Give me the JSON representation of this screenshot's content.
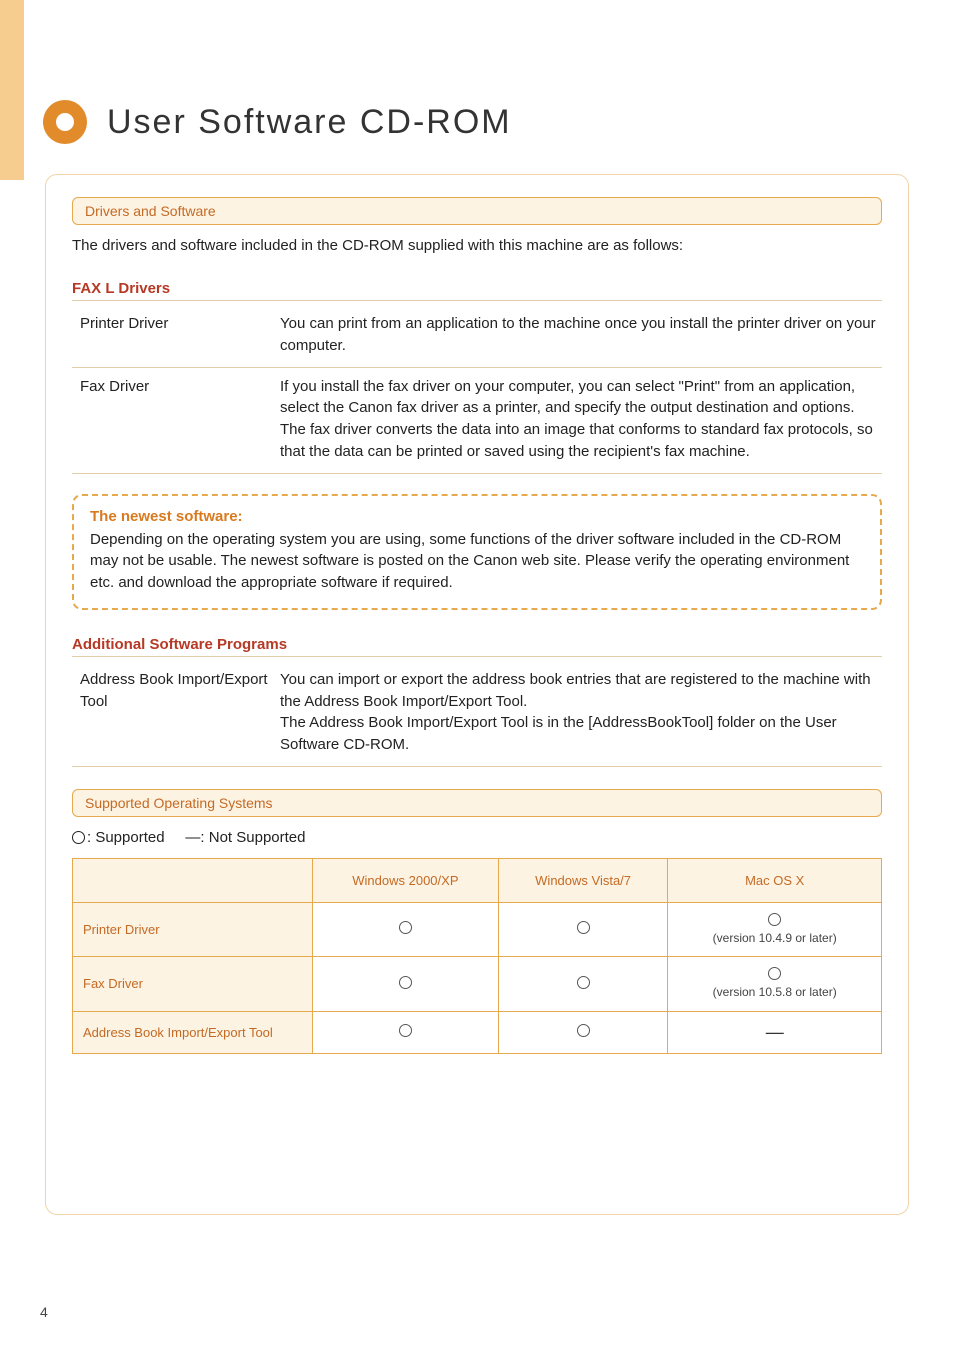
{
  "page_number": "4",
  "title": "User Software CD-ROM",
  "section_drivers_label": "Drivers and Software",
  "intro_text": "The drivers and software included in the CD-ROM supplied with this machine are as follows:",
  "fax_l_heading": "FAX L Drivers",
  "drivers": [
    {
      "name": "Printer Driver",
      "desc": "You can print from an application to the machine once you install the printer driver on your computer."
    },
    {
      "name": "Fax Driver",
      "desc": "If you install the fax driver on your computer, you can select \"Print\" from an application, select the Canon fax driver as a printer, and specify the output destination and options. The fax driver converts the data into an image that conforms to standard fax protocols, so that the data can be printed or saved using the recipient's fax machine."
    }
  ],
  "notice": {
    "title": "The newest software:",
    "body": "Depending on the operating system you are using, some functions of the driver software included in the CD-ROM may not be usable. The newest software is posted on the Canon web site. Please verify the operating environment etc. and download the appropriate software if required."
  },
  "additional_heading": "Additional Software Programs",
  "additional": [
    {
      "name": "Address Book Import/Export Tool",
      "desc_line1": "You can import or export the address book entries that are registered to the machine with the Address Book Import/Export Tool.",
      "desc_line2": "The Address Book Import/Export Tool is in the [AddressBookTool] folder on the User Software CD-ROM."
    }
  ],
  "section_os_label": "Supported Operating Systems",
  "legend_supported": ": Supported",
  "legend_not_supported": "—: Not Supported",
  "os_table": {
    "columns": [
      "Windows 2000/XP",
      "Windows Vista/7",
      "Mac OS X"
    ],
    "rows": [
      {
        "label": "Printer Driver",
        "cells": [
          "circle",
          "circle",
          {
            "type": "circle_note",
            "note": "(version 10.4.9 or later)"
          }
        ]
      },
      {
        "label": "Fax Driver",
        "cells": [
          "circle",
          "circle",
          {
            "type": "circle_note",
            "note": "(version 10.5.8 or later)"
          }
        ]
      },
      {
        "label": "Address Book Import/Export Tool",
        "cells": [
          "circle",
          "circle",
          "dash"
        ]
      }
    ]
  },
  "chart_data": {
    "type": "table",
    "title": "Supported Operating Systems",
    "columns": [
      "",
      "Windows 2000/XP",
      "Windows Vista/7",
      "Mac OS X"
    ],
    "rows": [
      [
        "Printer Driver",
        "Supported",
        "Supported",
        "Supported (version 10.4.9 or later)"
      ],
      [
        "Fax Driver",
        "Supported",
        "Supported",
        "Supported (version 10.5.8 or later)"
      ],
      [
        "Address Book Import/Export Tool",
        "Supported",
        "Supported",
        "Not Supported"
      ]
    ]
  }
}
